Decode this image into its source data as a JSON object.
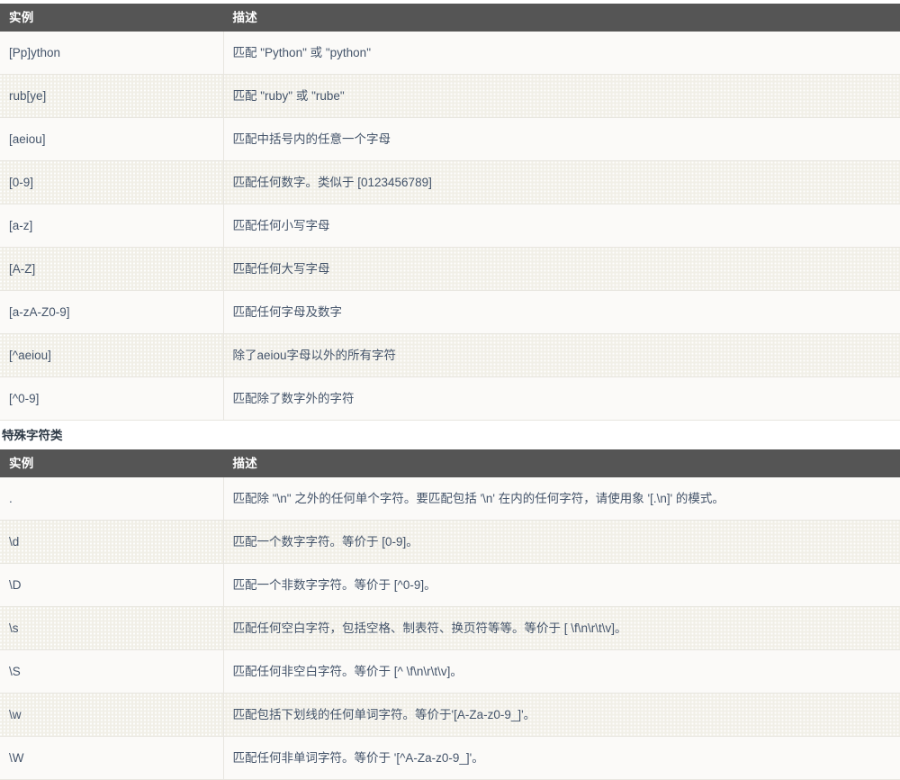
{
  "tables": [
    {
      "id": "character-class-table",
      "heading": null,
      "columns": [
        "实例",
        "描述"
      ],
      "rows": [
        {
          "example": "[Pp]ython",
          "description": "匹配 \"Python\" 或 \"python\""
        },
        {
          "example": "rub[ye]",
          "description": "匹配 \"ruby\" 或 \"rube\""
        },
        {
          "example": "[aeiou]",
          "description": "匹配中括号内的任意一个字母"
        },
        {
          "example": "[0-9]",
          "description": "匹配任何数字。类似于 [0123456789]"
        },
        {
          "example": "[a-z]",
          "description": "匹配任何小写字母"
        },
        {
          "example": "[A-Z]",
          "description": "匹配任何大写字母"
        },
        {
          "example": "[a-zA-Z0-9]",
          "description": "匹配任何字母及数字"
        },
        {
          "example": "[^aeiou]",
          "description": "除了aeiou字母以外的所有字符"
        },
        {
          "example": "[^0-9]",
          "description": "匹配除了数字外的字符"
        }
      ]
    },
    {
      "id": "special-character-class-table",
      "heading": "特殊字符类",
      "columns": [
        "实例",
        "描述"
      ],
      "rows": [
        {
          "example": ".",
          "description": "匹配除 \"\\n\" 之外的任何单个字符。要匹配包括 '\\n' 在内的任何字符，请使用象 '[.\\n]' 的模式。"
        },
        {
          "example": "\\d",
          "description": "匹配一个数字字符。等价于 [0-9]。"
        },
        {
          "example": "\\D",
          "description": "匹配一个非数字字符。等价于 [^0-9]。"
        },
        {
          "example": "\\s",
          "description": "匹配任何空白字符，包括空格、制表符、换页符等等。等价于 [ \\f\\n\\r\\t\\v]。"
        },
        {
          "example": "\\S",
          "description": "匹配任何非空白字符。等价于 [^ \\f\\n\\r\\t\\v]。"
        },
        {
          "example": "\\w",
          "description": "匹配包括下划线的任何单词字符。等价于'[A-Za-z0-9_]'。"
        },
        {
          "example": "\\W",
          "description": "匹配任何非单词字符。等价于 '[^A-Za-z0-9_]'。"
        }
      ]
    }
  ],
  "colors": {
    "header_background": "#555555",
    "header_text": "#ffffff",
    "row_odd_background": "#fbfaf8",
    "row_even_background": "#f1efe7",
    "cell_text": "#44546a",
    "border": "#e8e6e0"
  }
}
